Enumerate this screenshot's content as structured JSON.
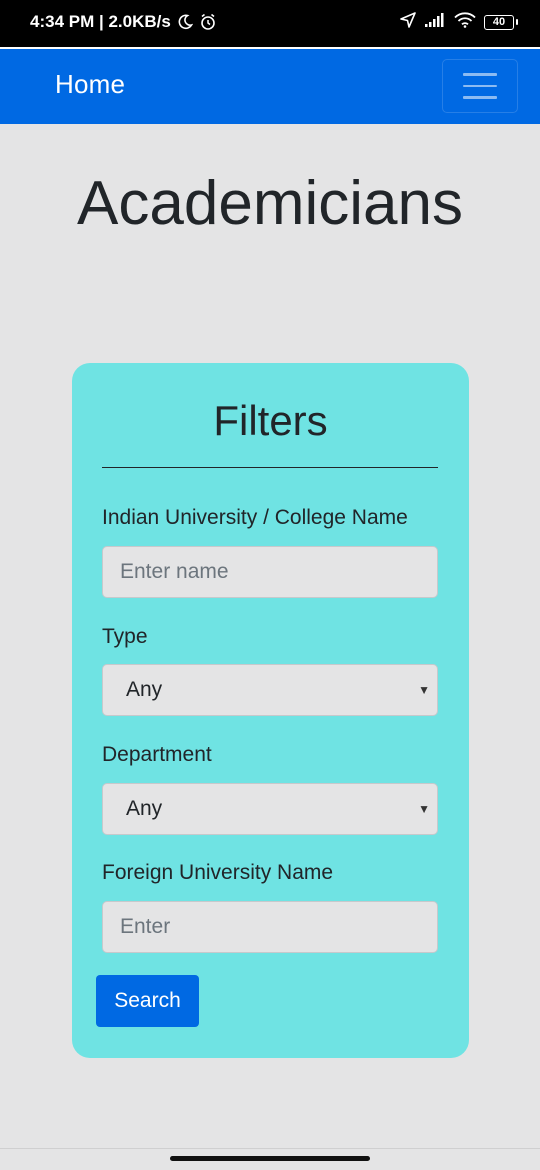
{
  "status_bar": {
    "time_speed": "4:34 PM | 2.0KB/s",
    "battery": "40"
  },
  "navbar": {
    "brand": "Home"
  },
  "page": {
    "title": "Academicians"
  },
  "filters": {
    "title": "Filters",
    "university": {
      "label": "Indian University / College Name",
      "placeholder": "Enter name",
      "value": ""
    },
    "type": {
      "label": "Type",
      "selected": "Any"
    },
    "department": {
      "label": "Department",
      "selected": "Any"
    },
    "foreign_university": {
      "label": "Foreign University Name",
      "placeholder": "Enter",
      "value": ""
    },
    "search_label": "Search"
  },
  "colors": {
    "primary": "#0069e3",
    "card_bg": "#6fe3e3",
    "page_bg": "#e4e4e5"
  },
  "icons": {
    "status": [
      "moon-icon",
      "alarm-icon",
      "navigation-arrow-icon",
      "signal-icon",
      "wifi-icon",
      "battery-icon"
    ],
    "navbar": [
      "hamburger-menu-icon"
    ],
    "select": [
      "caret-down-icon"
    ]
  }
}
